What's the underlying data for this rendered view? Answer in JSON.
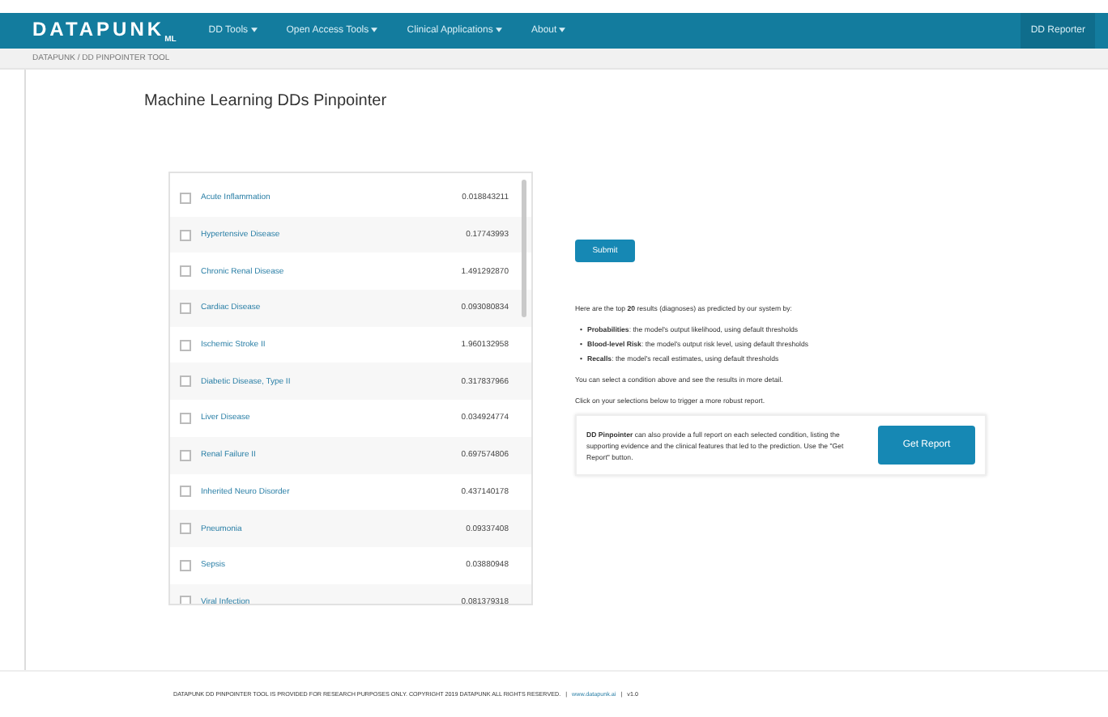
{
  "navbar": {
    "brand": "DATAPUNK",
    "brand_sub": "ML",
    "menus": [
      {
        "label": "DD Tools"
      },
      {
        "label": "Open Access Tools"
      },
      {
        "label": "Clinical Applications"
      },
      {
        "label": "About"
      }
    ],
    "user": "DD Reporter"
  },
  "breadcrumb": "DATAPUNK / DD PINPOINTER TOOL",
  "title": "Machine Learning DDs Pinpointer",
  "conditions": [
    {
      "name": "Acute Inflammation",
      "score": "0.018843211",
      "checked": false
    },
    {
      "name": "Hypertensive Disease",
      "score": "0.17743993",
      "checked": false
    },
    {
      "name": "Chronic Renal Disease",
      "score": "1.491292870",
      "checked": false
    },
    {
      "name": "Cardiac Disease",
      "score": "0.093080834",
      "checked": false
    },
    {
      "name": "Ischemic Stroke II",
      "score": "1.960132958",
      "checked": false
    },
    {
      "name": "Diabetic Disease, Type II",
      "score": "0.317837966",
      "checked": false
    },
    {
      "name": "Liver Disease",
      "score": "0.034924774",
      "checked": false
    },
    {
      "name": "Renal Failure II",
      "score": "0.697574806",
      "checked": false
    },
    {
      "name": "Inherited Neuro Disorder",
      "score": "0.437140178",
      "checked": false
    },
    {
      "name": "Pneumonia",
      "score": "0.09337408",
      "checked": false
    },
    {
      "name": "Sepsis",
      "score": "0.03880948",
      "checked": false
    },
    {
      "name": "Viral Infection",
      "score": "0.081379318",
      "checked": false
    }
  ],
  "submit": "Submit",
  "intro": "Here are the top **20** results (diagnoses) as predicted by our system by:",
  "bullets": [
    {
      "mark": "•",
      "text": "**Probabilities**: the model's output likelihood, using default thresholds"
    },
    {
      "mark": "•",
      "text": "**Blood-level Risk**: the model's output risk level, using default thresholds"
    },
    {
      "mark": "•",
      "text": "**Recalls**: the model's recall estimates, using default thresholds"
    }
  ],
  "note1": "You can select a condition above and see the results in more detail.",
  "note2": "Click on your selections below to trigger a more robust report.",
  "report_text": "**DD Pinpointer** can also provide a full report on each selected condition, listing the supporting evidence and the clinical features that led to the prediction. Use the \"Get Report\" button.",
  "report_button": "Get Report",
  "footer": "DATAPUNK DD PINPOINTER TOOL IS PROVIDED FOR RESEARCH PURPOSES ONLY. COPYRIGHT 2019 DATAPUNK ALL RIGHTS RESERVED.",
  "footer_link": "www.datapunk.ai",
  "footer_sep": "|",
  "footer_version": "v1.0"
}
